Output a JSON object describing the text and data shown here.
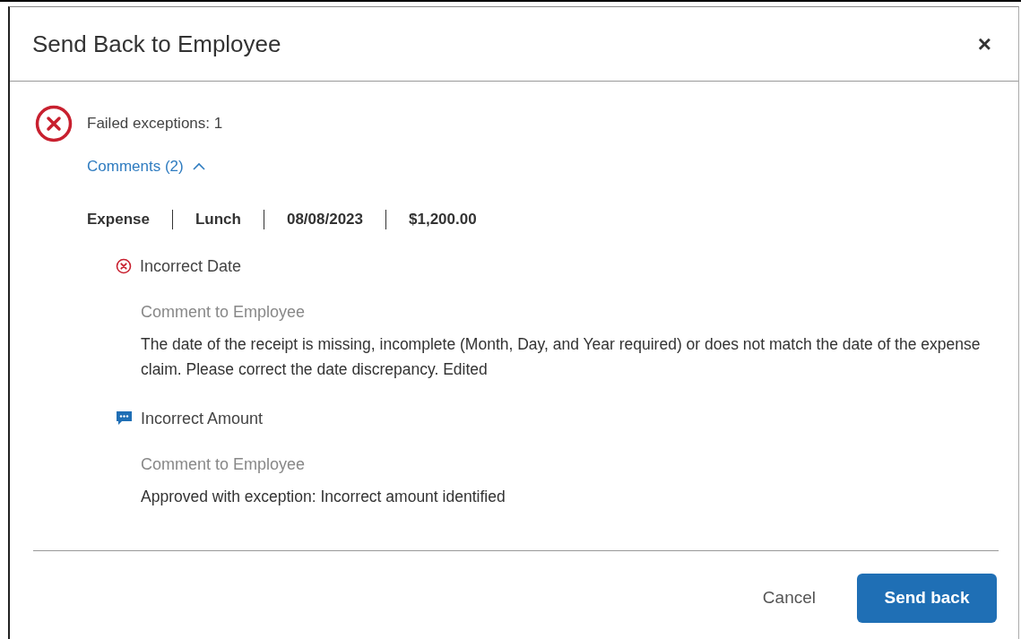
{
  "dialog": {
    "title": "Send Back to Employee",
    "close": "×"
  },
  "summary": {
    "text": "Failed exceptions: 1"
  },
  "comments_toggle": {
    "label": "Comments (2)",
    "expanded": true
  },
  "expense": [
    "Expense",
    "Lunch",
    "08/08/2023",
    "$1,200.00"
  ],
  "comments": [
    {
      "kind": "error",
      "title": "Incorrect Date",
      "label": "Comment to Employee",
      "text": "The date of the receipt is missing, incomplete (Month, Day, and Year required) or does not match the date of the expense claim. Please correct the date discrepancy. Edited"
    },
    {
      "kind": "comment",
      "title": "Incorrect Amount",
      "label": "Comment to Employee",
      "text": "Approved with exception: Incorrect amount identified"
    }
  ],
  "buttons": {
    "cancel": "Cancel",
    "confirm": "Send back"
  }
}
